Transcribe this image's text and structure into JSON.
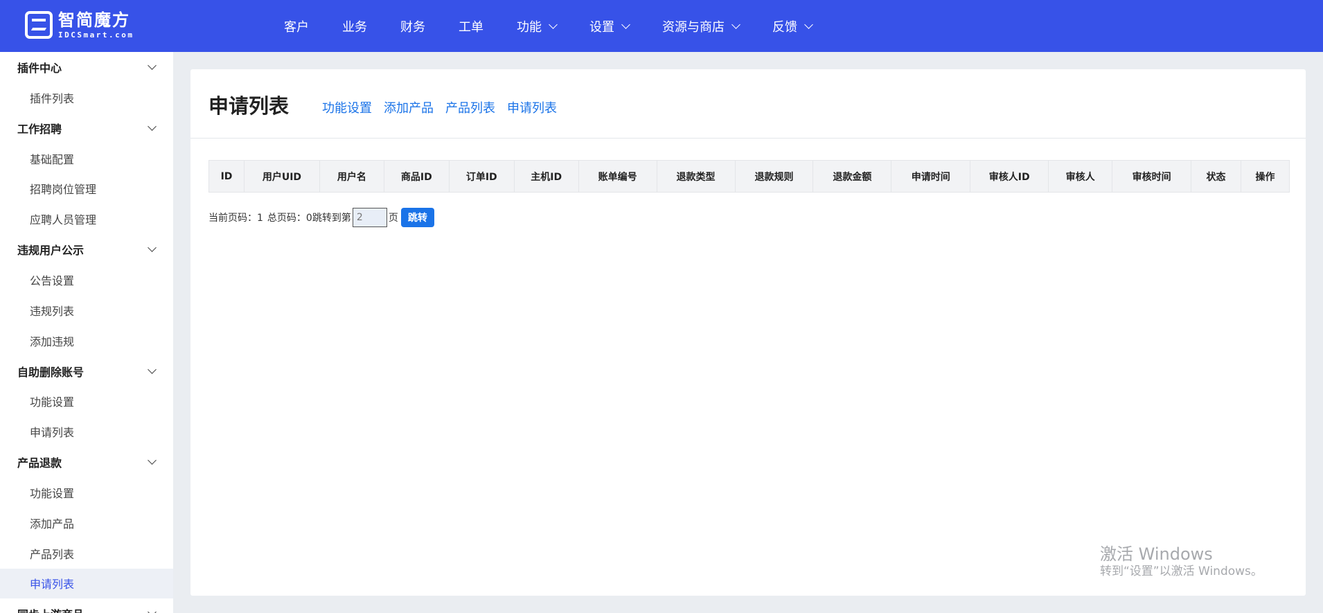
{
  "logo": {
    "cn": "智简魔方",
    "en": "IDCSmart.com"
  },
  "nav": [
    {
      "label": "客户",
      "dropdown": false
    },
    {
      "label": "业务",
      "dropdown": false
    },
    {
      "label": "财务",
      "dropdown": false
    },
    {
      "label": "工单",
      "dropdown": false
    },
    {
      "label": "功能",
      "dropdown": true
    },
    {
      "label": "设置",
      "dropdown": true
    },
    {
      "label": "资源与商店",
      "dropdown": true
    },
    {
      "label": "反馈",
      "dropdown": true
    }
  ],
  "sidebar": [
    {
      "type": "group",
      "label": "插件中心"
    },
    {
      "type": "item",
      "label": "插件列表"
    },
    {
      "type": "group",
      "label": "工作招聘"
    },
    {
      "type": "item",
      "label": "基础配置"
    },
    {
      "type": "item",
      "label": "招聘岗位管理"
    },
    {
      "type": "item",
      "label": "应聘人员管理"
    },
    {
      "type": "group",
      "label": "违规用户公示"
    },
    {
      "type": "item",
      "label": "公告设置"
    },
    {
      "type": "item",
      "label": "违规列表"
    },
    {
      "type": "item",
      "label": "添加违规"
    },
    {
      "type": "group",
      "label": "自助删除账号"
    },
    {
      "type": "item",
      "label": "功能设置"
    },
    {
      "type": "item",
      "label": "申请列表"
    },
    {
      "type": "group",
      "label": "产品退款"
    },
    {
      "type": "item",
      "label": "功能设置"
    },
    {
      "type": "item",
      "label": "添加产品"
    },
    {
      "type": "item",
      "label": "产品列表"
    },
    {
      "type": "item",
      "label": "申请列表",
      "active": true
    },
    {
      "type": "group",
      "label": "同步上游商品"
    }
  ],
  "page": {
    "title": "申请列表",
    "subnav": [
      "功能设置",
      "添加产品",
      "产品列表",
      "申请列表"
    ]
  },
  "table": {
    "columns": [
      "ID",
      "用户UID",
      "用户名",
      "商品ID",
      "订单ID",
      "主机ID",
      "账单编号",
      "退款类型",
      "退款规则",
      "退款金额",
      "申请时间",
      "审核人ID",
      "审核人",
      "审核时间",
      "状态",
      "操作"
    ],
    "rows": []
  },
  "pager": {
    "current_label": "当前页码：1",
    "total_label": "总页码：0",
    "jump_prefix": "跳转到第",
    "jump_value": "2",
    "jump_suffix": "页",
    "jump_button": "跳转"
  },
  "watermark": {
    "line1": "激活 Windows",
    "line2": "转到“设置”以激活 Windows。"
  }
}
